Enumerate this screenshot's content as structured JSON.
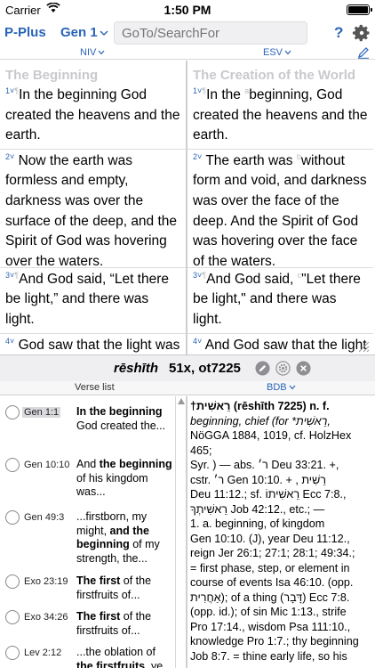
{
  "status": {
    "carrier": "Carrier",
    "time": "1:50 PM"
  },
  "toolbar": {
    "app_title": "P-Plus",
    "book": "Gen 1",
    "search_placeholder": "GoTo/SearchFor",
    "help": "?"
  },
  "versions": {
    "left": "NIV",
    "right": "ESV"
  },
  "left": {
    "heading": "The Beginning",
    "verses": [
      {
        "num": "1",
        "text": "In the beginning God created the heavens and the earth."
      },
      {
        "num": "2",
        "text": "Now the earth was formless and empty, darkness was over the surface of the deep, and the Spirit of God was hovering over the waters."
      },
      {
        "num": "3",
        "text": "And God said, “Let there be light,” and there was light."
      },
      {
        "num": "4",
        "text": "God saw that the light was good, and he separated the"
      }
    ]
  },
  "right": {
    "heading": "The Creation of the World",
    "verses": [
      {
        "num": "1",
        "fn": "a",
        "text1": "In the ",
        "text2": "beginning, God created the heavens and the earth."
      },
      {
        "num": "2",
        "fn": "b",
        "text1": "The earth was ",
        "text2": "without form and void, and darkness was over the face of the deep. And the Spirit of God was hovering over the face of the waters."
      },
      {
        "num": "3",
        "fn": "c",
        "text1": "And God said, ",
        "text2": "\"Let there be light,\" and there was light."
      },
      {
        "num": "4",
        "text": "And God saw that the light was good. And God"
      }
    ]
  },
  "lexicon": {
    "word": "rēshīth",
    "count": "51x, ot7225",
    "verse_list_label": "Verse list",
    "source": "BDB"
  },
  "verse_list": [
    {
      "ref": "Gen 1:1",
      "pre": "",
      "bold": "In the beginning",
      "post": " God created the..."
    },
    {
      "ref": "Gen 10:10",
      "pre": "And ",
      "bold": "the beginning",
      "post": " of his kingdom was..."
    },
    {
      "ref": "Gen 49:3",
      "pre": "...firstborn, my might, ",
      "bold": "and the beginning",
      "post": " of my strength, the..."
    },
    {
      "ref": "Exo 23:19",
      "pre": "",
      "bold": "The first",
      "post": " of the firstfruits of..."
    },
    {
      "ref": "Exo 34:26",
      "pre": "",
      "bold": "The first",
      "post": " of the firstfruits of..."
    },
    {
      "ref": "Lev 2:12",
      "pre": "...the oblation of ",
      "bold": "the firstfruits",
      "post": ", ye"
    }
  ],
  "lex_entry": {
    "l1": "†רֵאשִׁית (rēshīth 7225) n. f.",
    "l2": "beginning, chief (for *רֵאשִׁית,",
    "l3": "NöGGA 1884, 1019, cf. HolzHex 465;",
    "l4": "Syr. ) — abs. ר׳ Deu 33:21. +,",
    "l5": "cstr. ר׳ Gen 10:10. + , רֵשִׁית",
    "l6": "Deu 11:12.; sf. רֵאשִׁיתוֹ Ecc 7:8.,",
    "l7": "רֵאשִׁיתְךָ Job 42:12., etc.; —",
    "l8": "1. a. beginning, of kingdom",
    "l9": "Gen 10:10. (J), year Deu 11:12.,",
    "l10": "reign Jer 26:1; 27:1; 28:1; 49:34.;",
    "l11": "= first phase, step, or element in",
    "l12": "course of events Isa 46:10. (opp.",
    "l13": "אַחֲרִית); of a thing (דָּבָר) Ecc 7:8.",
    "l14": "(opp. id.); of sin Mic 1:13., strife",
    "l15": "Pro 17:14., wisdom Psa 111:10.,",
    "l16": "knowledge Pro 1:7.; thy beginning",
    "l17": "Job 8:7. = thine early life, so his"
  }
}
